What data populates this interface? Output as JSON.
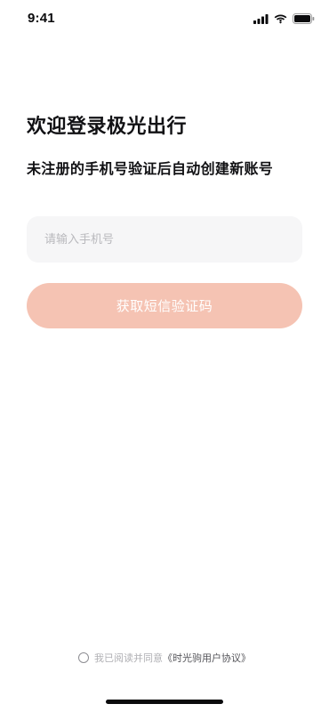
{
  "status_bar": {
    "time": "9:41",
    "icons": [
      "cellular-signal-icon",
      "wifi-icon",
      "battery-icon"
    ]
  },
  "login": {
    "title": "欢迎登录极光出行",
    "subtitle": "未注册的手机号验证后自动创建新账号",
    "phone_input": {
      "placeholder": "请输入手机号",
      "value": ""
    },
    "get_code_button": "获取短信验证码",
    "agreement": {
      "checked": false,
      "prefix": "我已阅读并同意",
      "link": "《时光驹用户协议》"
    }
  },
  "colors": {
    "accent_disabled": "#f5c3b3",
    "input_background": "#f6f6f7",
    "text_primary": "#111114",
    "placeholder": "#b9b9bd"
  }
}
